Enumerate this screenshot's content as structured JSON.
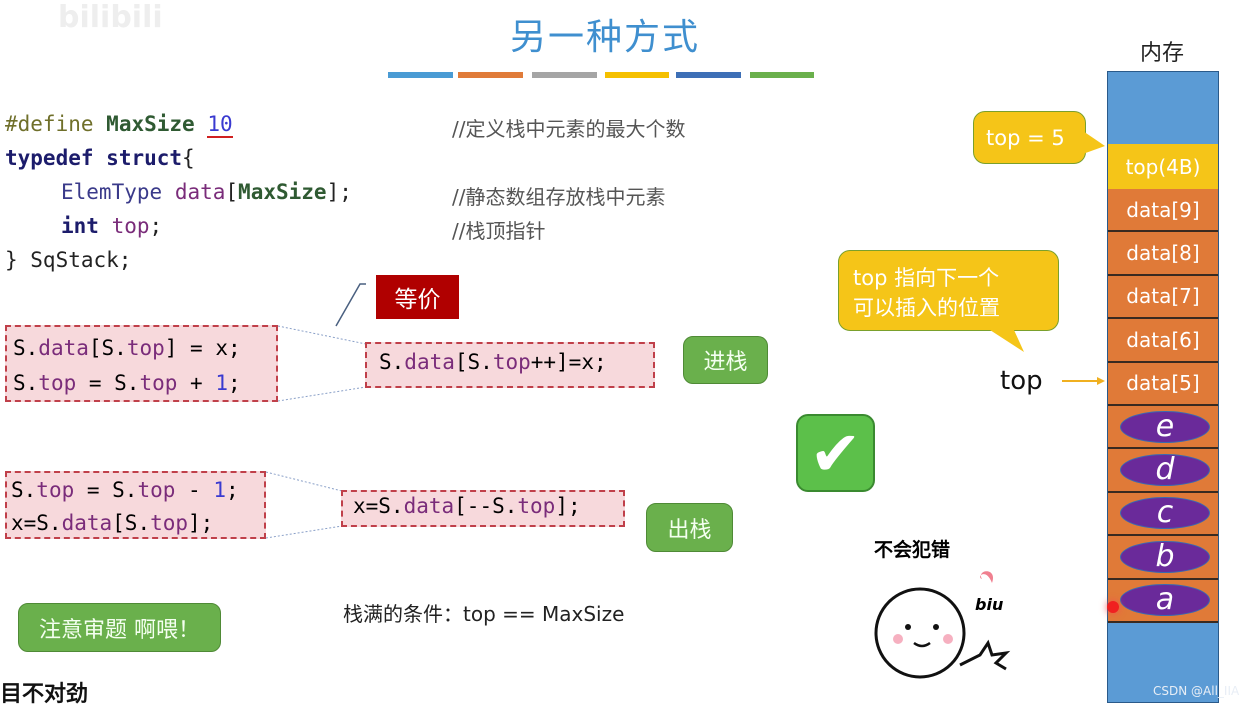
{
  "watermark": "bilibili",
  "title": "另一种方式",
  "accent_bars": [
    "#4a9bd4",
    "#e07b39",
    "#a5a5a5",
    "#f5c000",
    "#3d6fb6",
    "#6ab04c"
  ],
  "code": {
    "line1": {
      "define": "#define",
      "macro": "MaxSize",
      "value": "10",
      "comment": "//定义栈中元素的最大个数"
    },
    "line2": {
      "typedef": "typedef",
      "struct": "struct",
      "brace": "{"
    },
    "line3": {
      "type": "ElemType",
      "field": "data",
      "open": "[",
      "macro": "MaxSize",
      "close": "];",
      "comment": "//静态数组存放栈中元素"
    },
    "line4": {
      "type": "int",
      "field": "top",
      "semi": ";",
      "comment": "//栈顶指针"
    },
    "line5": {
      "text": "} SqStack;"
    }
  },
  "equiv_label": "等价",
  "push": {
    "line1": [
      "S.",
      "data",
      "[S.",
      "top",
      "] = x;"
    ],
    "line2": [
      "S.",
      "top",
      " = S.",
      "top",
      " + ",
      "1",
      ";"
    ],
    "combined": [
      "S.",
      "data",
      "[S.",
      "top",
      "++]=x;"
    ],
    "label": "进栈"
  },
  "pop": {
    "line1": [
      "S.",
      "top",
      " = S.",
      "top",
      " - ",
      "1",
      ";"
    ],
    "line2": [
      "x=S.",
      "data",
      "[S.",
      "top",
      "];"
    ],
    "combined": [
      "x=S.",
      "data",
      "[--S.",
      "top",
      "];"
    ],
    "label": "出栈"
  },
  "full_condition": "栈满的条件：top == MaxSize",
  "note_bubble": "注意审题 啊喂！",
  "bottom_left_caption": "目不对劲",
  "sticker": {
    "caption": "不会犯错",
    "text": "biu"
  },
  "memory": {
    "title": "内存",
    "top_cell": "top(4B)",
    "cells": [
      "data[9]",
      "data[8]",
      "data[7]",
      "data[6]",
      "data[5]",
      "",
      "",
      "",
      "",
      ""
    ],
    "elements": [
      "e",
      "d",
      "c",
      "b",
      "a"
    ],
    "top_value_bubble": "top = 5",
    "pointer_bubble": "top 指向下一个\n可以插入的位置",
    "pointer_label": "top"
  },
  "credit": "CSDN @All_IIA"
}
